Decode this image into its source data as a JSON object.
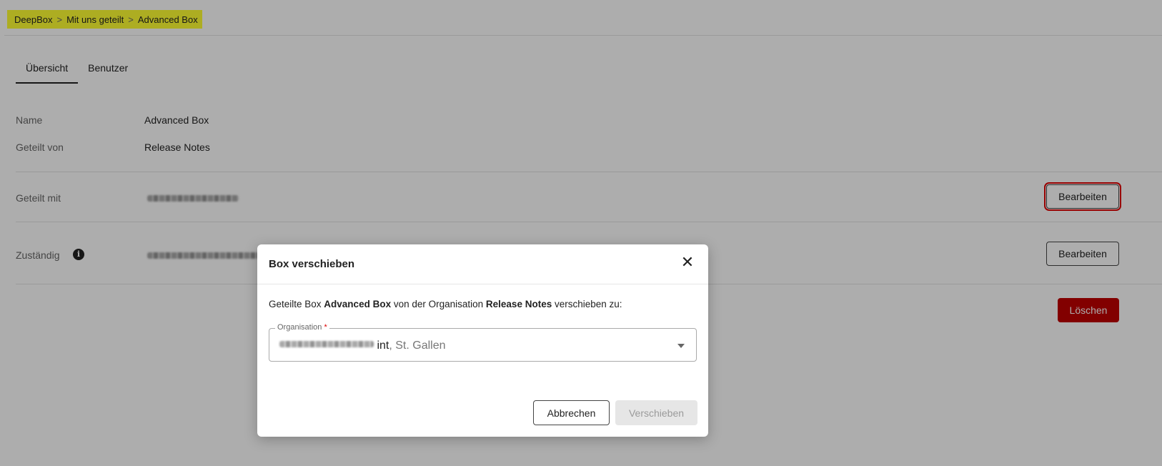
{
  "breadcrumb": {
    "items": [
      "DeepBox",
      "Mit uns geteilt",
      "Advanced Box"
    ],
    "separator": ">"
  },
  "tabs": [
    {
      "label": "Übersicht",
      "active": true
    },
    {
      "label": "Benutzer",
      "active": false
    }
  ],
  "details": {
    "name_label": "Name",
    "name_value": "Advanced Box",
    "shared_by_label": "Geteilt von",
    "shared_by_value": "Release Notes",
    "shared_with_label": "Geteilt mit",
    "responsible_label": "Zuständig",
    "info_icon": "info-icon"
  },
  "buttons": {
    "edit_shared_with": "Bearbeiten",
    "edit_responsible": "Bearbeiten",
    "delete": "Löschen"
  },
  "dialog": {
    "title": "Box verschieben",
    "text_prefix": "Geteilte Box ",
    "text_box": "Advanced Box",
    "text_middle": " von der Organisation ",
    "text_org": "Release Notes",
    "text_suffix": " verschieben zu:",
    "select_label": "Organisation",
    "select_required": "*",
    "select_value_visible": "int",
    "select_value_suffix": ", St. Gallen",
    "cancel_label": "Abbrechen",
    "move_label": "Verschieben"
  },
  "colors": {
    "breadcrumb_highlight": "#ffff33",
    "danger": "#c00000",
    "annotation_red": "#e00000",
    "overlay": "rgba(0,0,0,0.32)"
  }
}
